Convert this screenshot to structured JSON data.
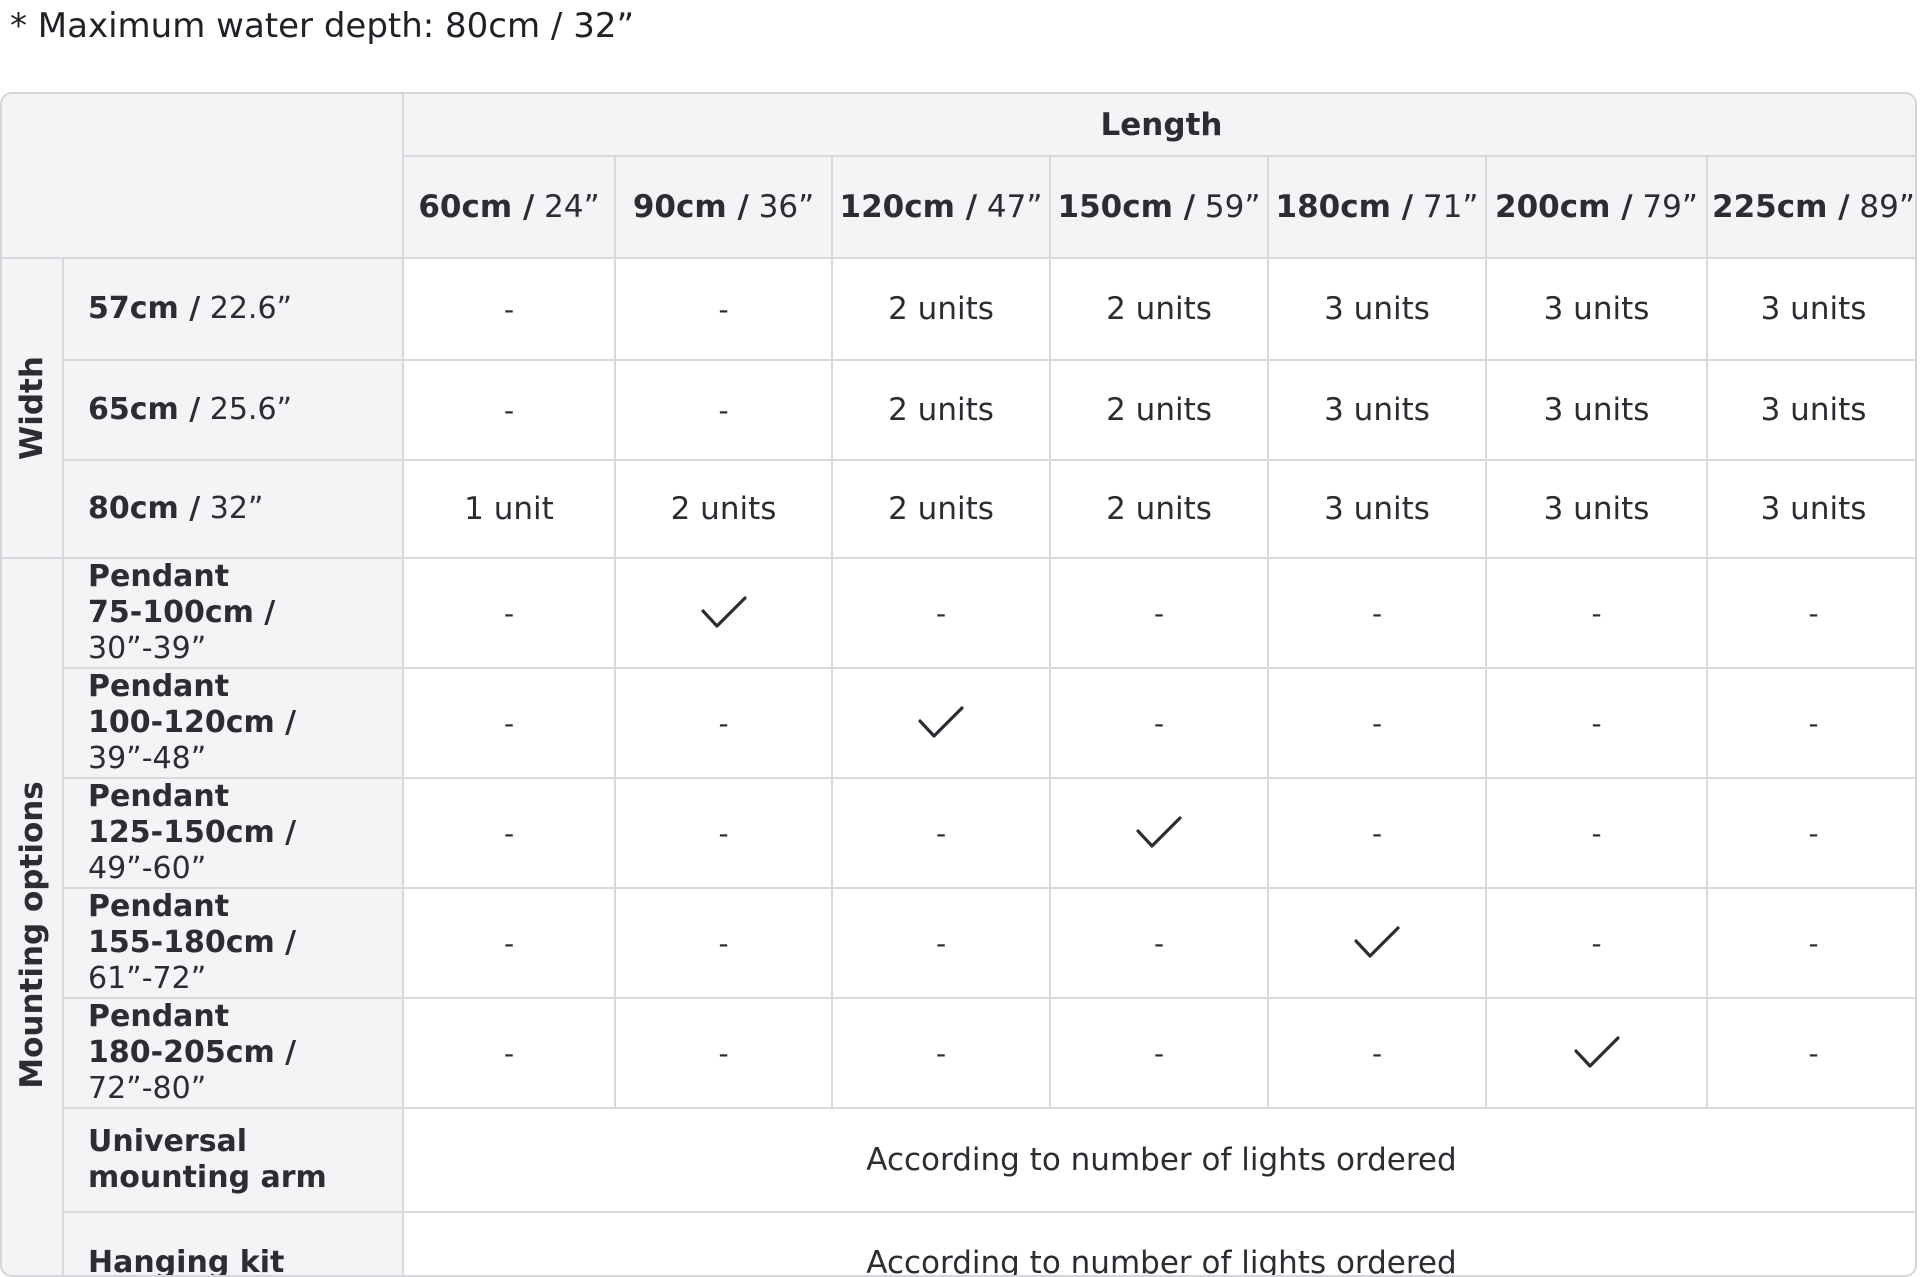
{
  "note": "* Maximum water depth: 80cm / 32”",
  "table": {
    "length_header": "Length",
    "columns": [
      {
        "metric": "60cm /",
        "imperial": " 24”"
      },
      {
        "metric": "90cm /",
        "imperial": " 36”"
      },
      {
        "metric": "120cm /",
        "imperial": " 47”"
      },
      {
        "metric": "150cm /",
        "imperial": " 59”"
      },
      {
        "metric": "180cm /",
        "imperial": " 71”"
      },
      {
        "metric": "200cm /",
        "imperial": " 79”"
      },
      {
        "metric": "225cm /",
        "imperial": " 89”"
      }
    ],
    "width_group_label": "Width",
    "width_rows": [
      {
        "metric": "57cm /",
        "imperial": " 22.6”",
        "cells": [
          "-",
          "-",
          "2 units",
          "2 units",
          "3 units",
          "3 units",
          "3 units"
        ]
      },
      {
        "metric": "65cm /",
        "imperial": " 25.6”",
        "cells": [
          "-",
          "-",
          "2 units",
          "2 units",
          "3 units",
          "3 units",
          "3 units"
        ]
      },
      {
        "metric": "80cm /",
        "imperial": " 32”",
        "cells": [
          "1 unit",
          "2 units",
          "2 units",
          "2 units",
          "3 units",
          "3 units",
          "3 units"
        ]
      }
    ],
    "mounting_group_label": "Mounting options",
    "pendant_rows": [
      {
        "line1": "Pendant",
        "metric": "75-100cm /",
        "imperial": " 30”-39”",
        "cells": [
          "-",
          "check",
          "-",
          "-",
          "-",
          "-",
          "-"
        ]
      },
      {
        "line1": "Pendant",
        "metric": "100-120cm /",
        "imperial": " 39”-48”",
        "cells": [
          "-",
          "-",
          "check",
          "-",
          "-",
          "-",
          "-"
        ]
      },
      {
        "line1": "Pendant",
        "metric": "125-150cm /",
        "imperial": " 49”-60”",
        "cells": [
          "-",
          "-",
          "-",
          "check",
          "-",
          "-",
          "-"
        ]
      },
      {
        "line1": "Pendant",
        "metric": "155-180cm /",
        "imperial": " 61”-72”",
        "cells": [
          "-",
          "-",
          "-",
          "-",
          "check",
          "-",
          "-"
        ]
      },
      {
        "line1": "Pendant",
        "metric": "180-205cm /",
        "imperial": " 72”-80”",
        "cells": [
          "-",
          "-",
          "-",
          "-",
          "-",
          "check",
          "-"
        ]
      }
    ],
    "wide_rows": [
      {
        "line1": "Universal",
        "line2": "mounting arm",
        "text": "According to number of lights ordered"
      },
      {
        "line1": "Hanging kit",
        "line2": "",
        "text": "According to number of lights ordered"
      }
    ],
    "check_icon": "checkmark-icon"
  }
}
